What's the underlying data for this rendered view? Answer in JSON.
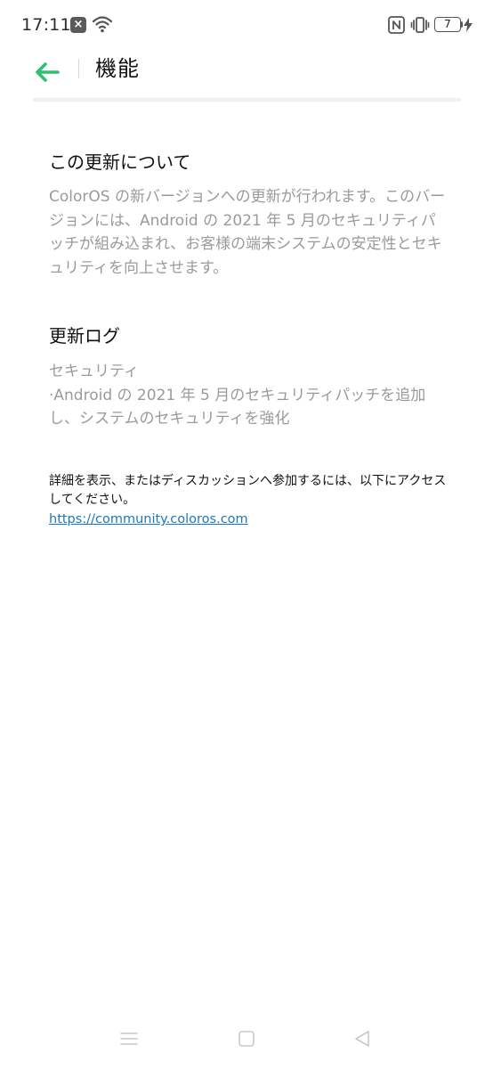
{
  "status_bar": {
    "time": "17:11",
    "battery_level": "7",
    "icons": [
      "notification-x-icon",
      "wifi-icon",
      "nfc-icon",
      "vibrate-icon",
      "battery-icon",
      "charging-bolt-icon"
    ]
  },
  "header": {
    "title": "機能",
    "back_icon": "back-arrow-icon",
    "accent_color": "#2fbf71"
  },
  "about": {
    "title": "この更新について",
    "body": "ColorOS の新バージョンへの更新が行われます。このバージョンには、Android の 2021 年 5 月のセキュリティパッチが組み込まれ、お客様の端末システムの安定性とセキュリティを向上させます。"
  },
  "update_log": {
    "title": "更新ログ",
    "lines": [
      "セキュリティ",
      "·Android の 2021 年 5 月のセキュリティパッチを追加し、システムのセキュリティを強化"
    ]
  },
  "more_info": {
    "text": "詳細を表示、またはディスカッションへ参加するには、以下にアクセスしてください。",
    "link": "https://community.coloros.com"
  },
  "nav_bar": {
    "icons": [
      "menu-icon",
      "home-icon",
      "back-icon"
    ]
  }
}
